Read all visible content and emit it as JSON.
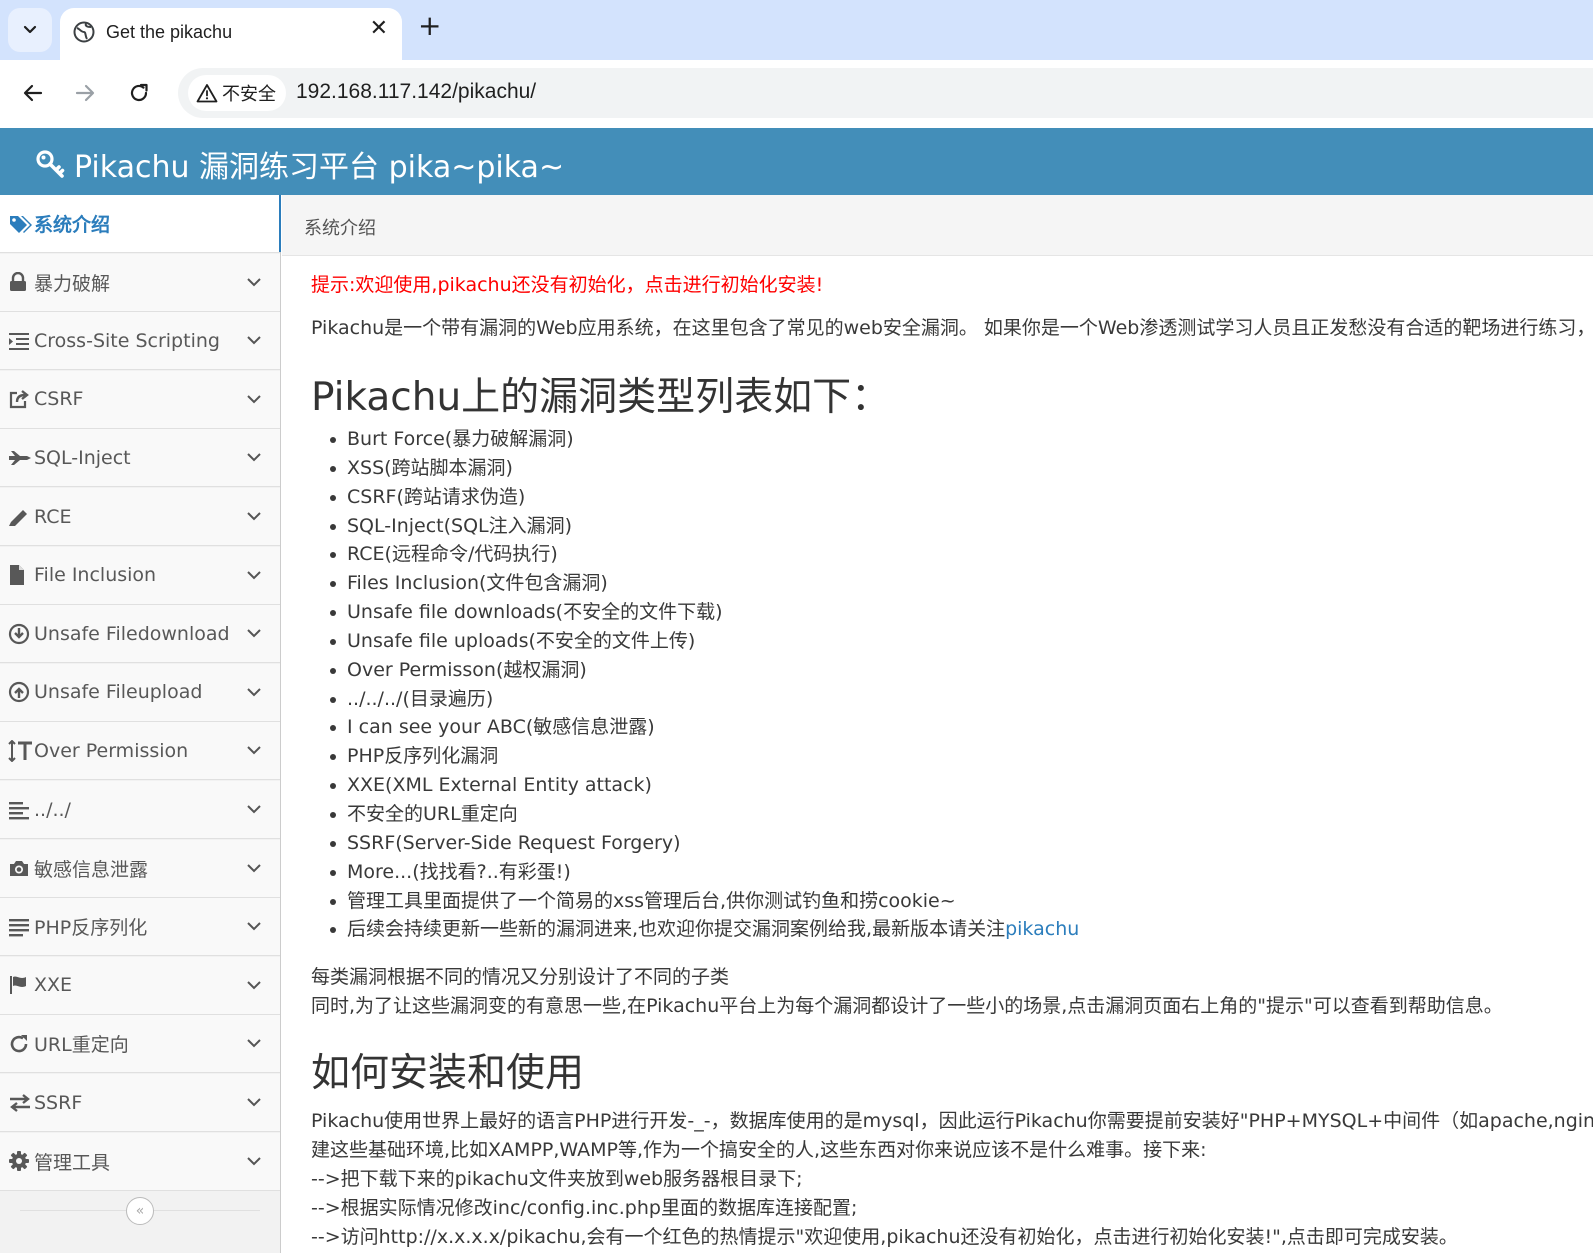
{
  "browser": {
    "tab_title": "Get the pikachu",
    "security_label": "不安全",
    "url": "192.168.117.142/pikachu/"
  },
  "header": {
    "brand": "Pikachu 漏洞练习平台 pika~pika~"
  },
  "sidebar": {
    "items": [
      {
        "label": "系统介绍",
        "icon": "tags-icon"
      },
      {
        "label": "暴力破解",
        "icon": "lock-icon"
      },
      {
        "label": "Cross-Site Scripting",
        "icon": "list-indent-icon"
      },
      {
        "label": "CSRF",
        "icon": "share-square-icon"
      },
      {
        "label": "SQL-Inject",
        "icon": "fighter-jet-icon"
      },
      {
        "label": "RCE",
        "icon": "pencil-icon"
      },
      {
        "label": "File Inclusion",
        "icon": "file-icon"
      },
      {
        "label": "Unsafe Filedownload",
        "icon": "download-circle-icon"
      },
      {
        "label": "Unsafe Fileupload",
        "icon": "upload-circle-icon"
      },
      {
        "label": "Over Permission",
        "icon": "text-height-icon"
      },
      {
        "label": "../../",
        "icon": "align-left-icon"
      },
      {
        "label": "敏感信息泄露",
        "icon": "camera-icon"
      },
      {
        "label": "PHP反序列化",
        "icon": "align-justify-icon"
      },
      {
        "label": "XXE",
        "icon": "flag-icon"
      },
      {
        "label": "URL重定向",
        "icon": "refresh-icon"
      },
      {
        "label": "SSRF",
        "icon": "exchange-icon"
      },
      {
        "label": "管理工具",
        "icon": "gear-icon"
      }
    ],
    "collapse_glyph": "«"
  },
  "breadcrumb": {
    "current": "系统介绍"
  },
  "content": {
    "notice": "提示:欢迎使用,pikachu还没有初始化，点击进行初始化安装!",
    "intro": "Pikachu是一个带有漏洞的Web应用系统，在这里包含了常见的web安全漏洞。 如果你是一个Web渗透测试学习人员且正发愁没有合适的靶场进行练习，",
    "vuln_heading": "Pikachu上的漏洞类型列表如下：",
    "vuln_list": [
      "Burt Force(暴力破解漏洞)",
      "XSS(跨站脚本漏洞)",
      "CSRF(跨站请求伪造)",
      "SQL-Inject(SQL注入漏洞)",
      "RCE(远程命令/代码执行)",
      "Files Inclusion(文件包含漏洞)",
      "Unsafe file downloads(不安全的文件下载)",
      "Unsafe file uploads(不安全的文件上传)",
      "Over Permisson(越权漏洞)",
      "../../../(目录遍历)",
      "I can see your ABC(敏感信息泄露)",
      "PHP反序列化漏洞",
      "XXE(XML External Entity attack)",
      "不安全的URL重定向",
      "SSRF(Server-Side Request Forgery)",
      "More...(找找看?..有彩蛋!)",
      "管理工具里面提供了一个简易的xss管理后台,供你测试钓鱼和捞cookie~"
    ],
    "last_item_text": "后续会持续更新一些新的漏洞进来,也欢迎你提交漏洞案例给我,最新版本请关注",
    "last_item_link": "pikachu",
    "para1": "每类漏洞根据不同的情况又分别设计了不同的子类",
    "para2": "同时,为了让这些漏洞变的有意思一些,在Pikachu平台上为每个漏洞都设计了一些小的场景,点击漏洞页面右上角的\"提示\"可以查看到帮助信息。",
    "install_heading": "如何安装和使用",
    "install_lines": [
      "Pikachu使用世界上最好的语言PHP进行开发-_-，数据库使用的是mysql，因此运行Pikachu你需要提前安装好\"PHP+MYSQL+中间件（如apache,nginx等）\"的",
      "建这些基础环境,比如XAMPP,WAMP等,作为一个搞安全的人,这些东西对你来说应该不是什么难事。接下来:",
      "-->把下载下来的pikachu文件夹放到web服务器根目录下;",
      "-->根据实际情况修改inc/config.inc.php里面的数据库连接配置;",
      "-->访问http://x.x.x.x/pikachu,会有一个红色的热情提示\"欢迎使用,pikachu还没有初始化，点击进行初始化安装!\",点击即可完成安装。"
    ]
  },
  "colors": {
    "header_bg": "#438eb9",
    "accent": "#2b7dbc",
    "notice": "#ff0000"
  }
}
